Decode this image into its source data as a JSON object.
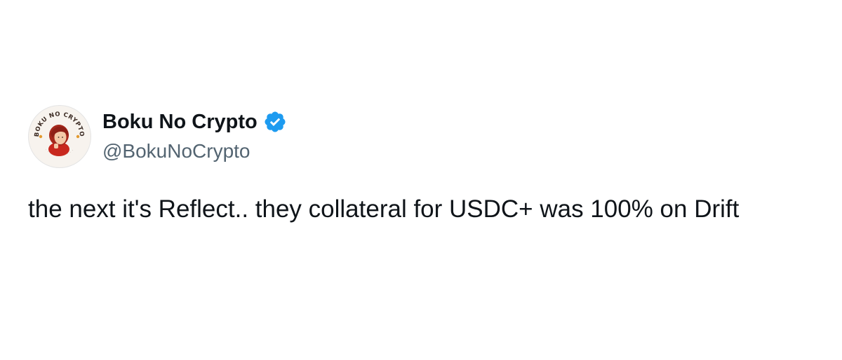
{
  "tweet": {
    "author": {
      "display_name": "Boku No Crypto",
      "handle": "@BokuNoCrypto",
      "verified": true,
      "avatar_text": "BOKU NO CRYPTO",
      "verified_color": "#1d9bf0"
    },
    "text": "the next it's Reflect.. they collateral for USDC+ was 100% on Drift"
  }
}
